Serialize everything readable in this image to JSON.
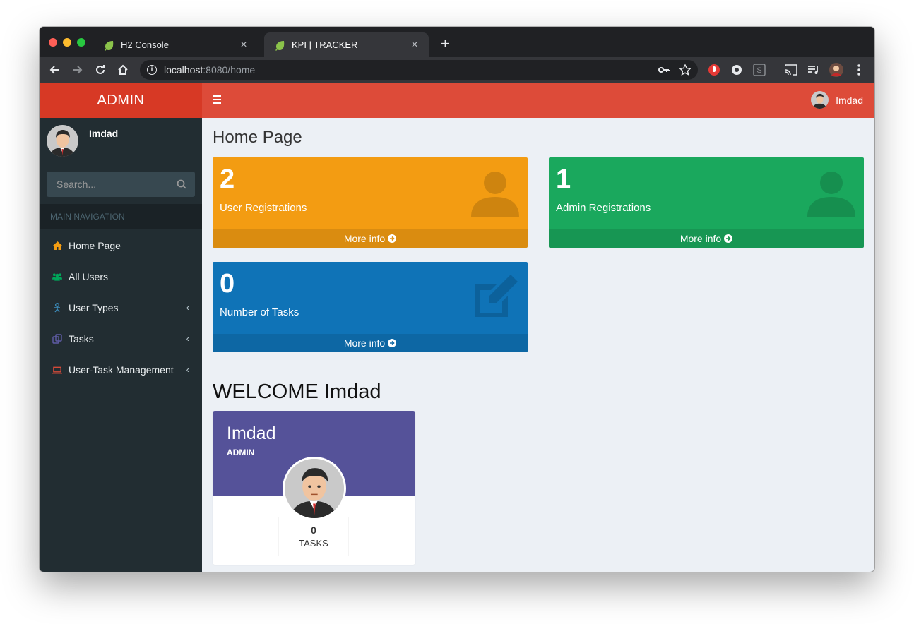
{
  "browser": {
    "tabs": [
      {
        "title": "H2 Console",
        "close": "×"
      },
      {
        "title": "KPI | TRACKER",
        "close": "×"
      }
    ],
    "new_tab": "+",
    "url_host": "localhost",
    "url_rest": ":8080/home"
  },
  "app": {
    "logo": "ADMIN",
    "nav_user": "Imdad",
    "sidebar": {
      "user_name": "Imdad",
      "search_placeholder": "Search...",
      "nav_header": "MAIN NAVIGATION",
      "items": [
        {
          "label": "Home Page",
          "icon": "home-icon",
          "color": "#f39c12"
        },
        {
          "label": "All Users",
          "icon": "users-icon",
          "color": "#00a65a"
        },
        {
          "label": "User Types",
          "icon": "user-types-icon",
          "color": "#3c8dbc",
          "chevron": "‹"
        },
        {
          "label": "Tasks",
          "icon": "tasks-icon",
          "color": "#605ca8",
          "chevron": "‹"
        },
        {
          "label": "User-Task Management",
          "icon": "laptop-icon",
          "color": "#dd4b39",
          "chevron": "‹"
        }
      ]
    }
  },
  "content": {
    "page_title": "Home Page",
    "boxes": [
      {
        "count": "2",
        "caption": "User Registrations",
        "footer": "More info",
        "color": "#f39c12",
        "icon": "user-icon"
      },
      {
        "count": "1",
        "caption": "Admin Registrations",
        "footer": "More info",
        "color": "#1aa85d",
        "icon": "user-icon"
      },
      {
        "count": "0",
        "caption": "Number of Tasks",
        "footer": "More info",
        "color": "#0f73b7",
        "icon": "edit-icon"
      }
    ],
    "welcome": "WELCOME Imdad",
    "widget": {
      "name": "Imdad",
      "role": "ADMIN",
      "stat_value": "0",
      "stat_label": "TASKS"
    }
  }
}
